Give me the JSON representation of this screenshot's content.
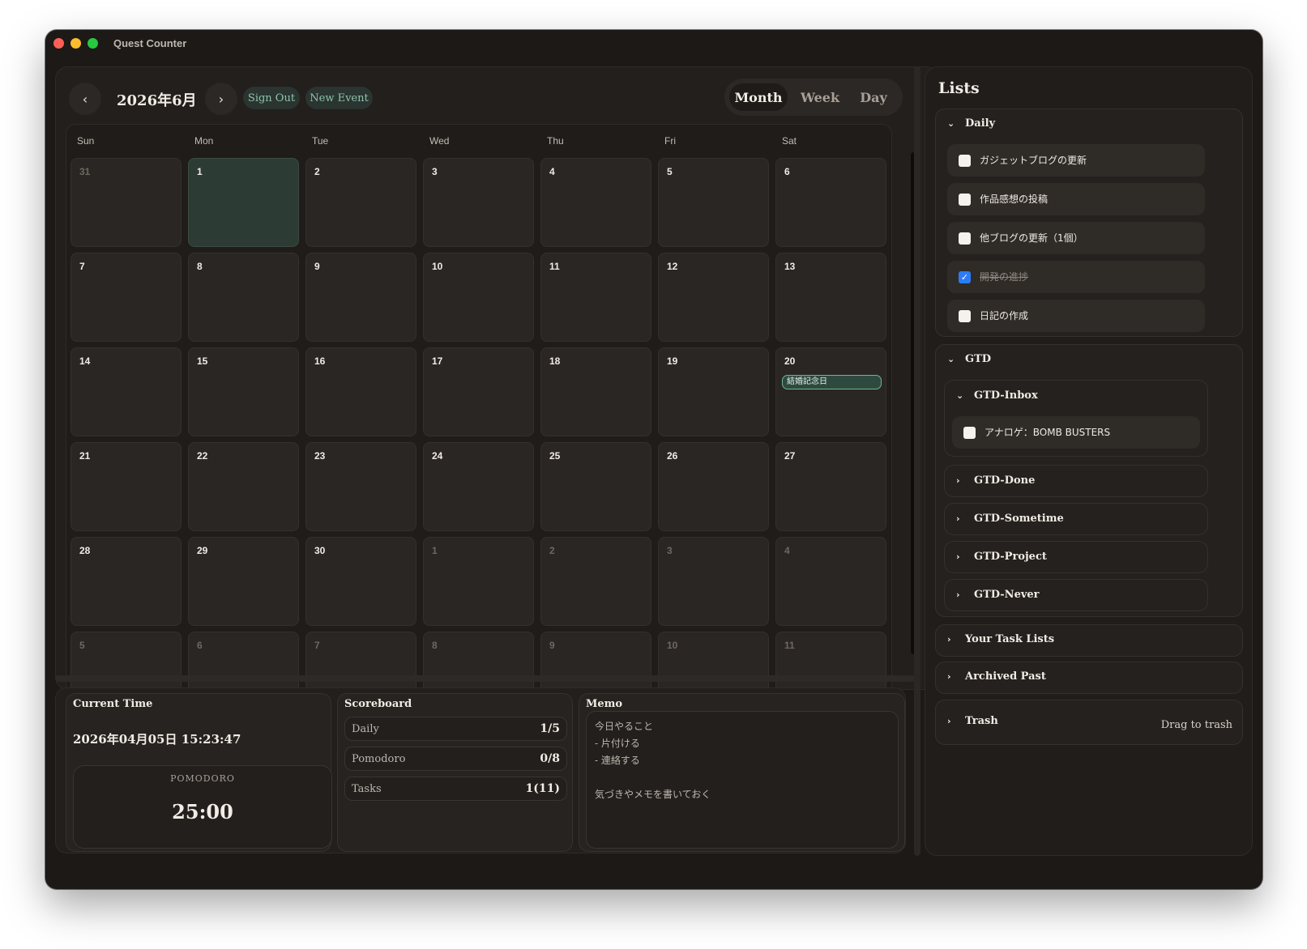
{
  "window": {
    "title": "Quest Counter"
  },
  "calendar": {
    "month_title": "2026年6月",
    "prev_icon": "‹",
    "next_icon": "›",
    "sign_out": "Sign Out",
    "new_event": "New Event",
    "views": {
      "month": "Month",
      "week": "Week",
      "day": "Day",
      "active": "Month"
    },
    "weekdays": [
      "Sun",
      "Mon",
      "Tue",
      "Wed",
      "Thu",
      "Fri",
      "Sat"
    ],
    "weeks": [
      [
        "31",
        "1",
        "2",
        "3",
        "4",
        "5",
        "6"
      ],
      [
        "7",
        "8",
        "9",
        "10",
        "11",
        "12",
        "13"
      ],
      [
        "14",
        "15",
        "16",
        "17",
        "18",
        "19",
        "20"
      ],
      [
        "21",
        "22",
        "23",
        "24",
        "25",
        "26",
        "27"
      ],
      [
        "28",
        "29",
        "30",
        "1",
        "2",
        "3",
        "4"
      ],
      [
        "5",
        "6",
        "7",
        "8",
        "9",
        "10",
        "11"
      ]
    ],
    "other_month": [
      [
        0,
        0
      ],
      [
        4,
        3
      ],
      [
        4,
        4
      ],
      [
        4,
        5
      ],
      [
        4,
        6
      ],
      [
        5,
        0
      ],
      [
        5,
        1
      ],
      [
        5,
        2
      ],
      [
        5,
        3
      ],
      [
        5,
        4
      ],
      [
        5,
        5
      ],
      [
        5,
        6
      ]
    ],
    "today": [
      0,
      1
    ],
    "events": [
      {
        "week": 2,
        "day": 6,
        "title": "結婚記念日"
      }
    ],
    "colors": {
      "today_bg": "#2d3b35",
      "event_border": "#6fb597",
      "accent": "#8fc3ad"
    }
  },
  "current_time": {
    "title": "Current Time",
    "value": "2026年04月05日 15:23:47",
    "pomodoro_label": "POMODORO",
    "pomodoro_time": "25:00"
  },
  "scoreboard": {
    "title": "Scoreboard",
    "rows": [
      {
        "label": "Daily",
        "value": "1/5"
      },
      {
        "label": "Pomodoro",
        "value": "0/8"
      },
      {
        "label": "Tasks",
        "value": "1(11)"
      }
    ]
  },
  "memo": {
    "title": "Memo",
    "text": "今日やること\n- 片付ける\n- 連絡する\n\n気づきやメモを書いておく"
  },
  "lists": {
    "title": "Lists",
    "daily": {
      "label": "Daily",
      "items": [
        {
          "label": "ガジェットブログの更新",
          "checked": false
        },
        {
          "label": "作品感想の投稿",
          "checked": false
        },
        {
          "label": "他ブログの更新（1個）",
          "checked": false
        },
        {
          "label": "開発の進捗",
          "checked": true
        },
        {
          "label": "日記の作成",
          "checked": false
        }
      ]
    },
    "gtd": {
      "label": "GTD",
      "inbox": {
        "label": "GTD-Inbox",
        "items": [
          {
            "label": "アナロゲ：BOMB BUSTERS",
            "checked": false
          }
        ]
      },
      "done": "GTD-Done",
      "sometime": "GTD-Sometime",
      "project": "GTD-Project",
      "never": "GTD-Never"
    },
    "your_task_lists": "Your Task Lists",
    "archived_past": "Archived Past",
    "trash": "Trash",
    "drag_hint": "Drag to trash"
  }
}
